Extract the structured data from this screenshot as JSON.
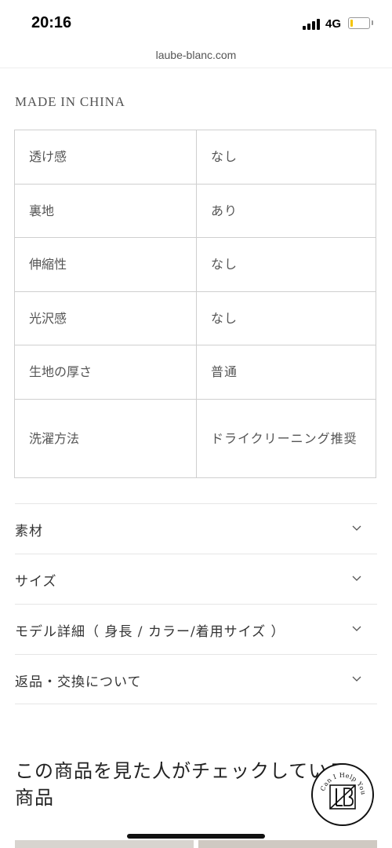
{
  "status_bar": {
    "time": "20:16",
    "network": "4G",
    "battery_level": 0.15,
    "battery_color": "#f5c400"
  },
  "browser": {
    "url": "laube-blanc.com"
  },
  "product": {
    "origin": "MADE IN CHINA",
    "specs": [
      {
        "key": "透け感",
        "value": "なし"
      },
      {
        "key": "裏地",
        "value": "あり"
      },
      {
        "key": "伸縮性",
        "value": "なし"
      },
      {
        "key": "光沢感",
        "value": "なし"
      },
      {
        "key": "生地の厚さ",
        "value": "普通"
      },
      {
        "key": "洗濯方法",
        "value": "ドライクリーニング推奨"
      }
    ]
  },
  "accordion": {
    "items": [
      {
        "label": "素材",
        "icon": "chevron-down-icon"
      },
      {
        "label": "サイズ",
        "icon": "chevron-down-icon"
      },
      {
        "label": "モデル詳細（ 身長 / カラー/着用サイズ ）",
        "icon": "chevron-down-icon"
      },
      {
        "label": "返品・交換について",
        "icon": "chevron-down-icon"
      }
    ]
  },
  "recommendations": {
    "title": "この商品を見た人がチェックしている商品"
  },
  "chat_badge": {
    "text": "Can I Help You?",
    "logo_letters": "LB"
  }
}
